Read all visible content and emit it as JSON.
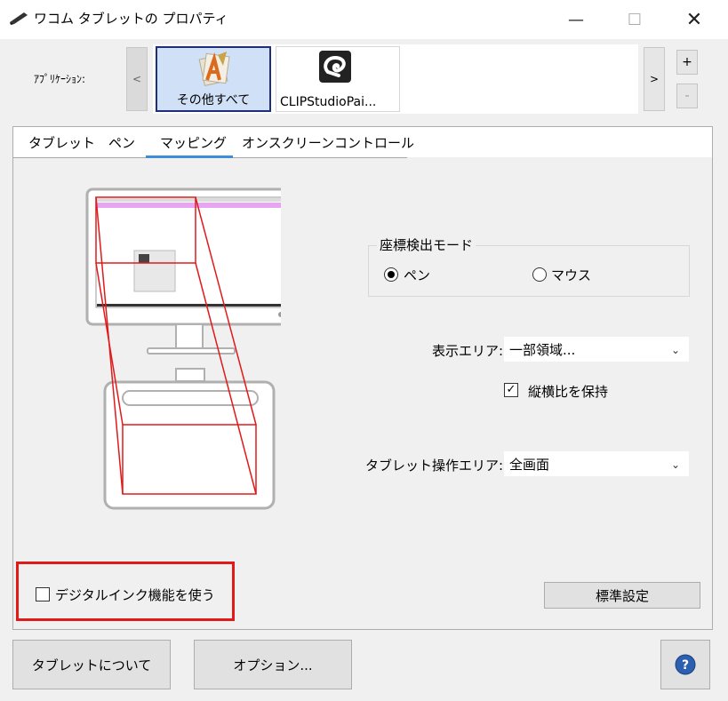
{
  "window": {
    "title": "ワコム タブレットの プロパティ",
    "minimize_glyph": "—",
    "maximize_glyph": "☐",
    "close_glyph": "✕"
  },
  "applications": {
    "label": "ｱﾌﾟﾘｹｰｼｮﾝ:",
    "scroll_left_glyph": "<",
    "scroll_right_glyph": ">",
    "add_glyph": "+",
    "remove_glyph": "-",
    "items": [
      {
        "label": "その他すべて",
        "icon": "all-apps-icon",
        "selected": true
      },
      {
        "label": "CLIPStudioPai...",
        "icon": "clip-studio-icon",
        "selected": false
      }
    ]
  },
  "tabs": [
    {
      "label": "タブレット",
      "active": false
    },
    {
      "label": "ペン",
      "active": false
    },
    {
      "label": "マッピング",
      "active": true
    },
    {
      "label": "オンスクリーンコントロール",
      "active": false
    }
  ],
  "mapping": {
    "coord_mode": {
      "legend": "座標検出モード",
      "pen_label": "ペン",
      "mouse_label": "マウス",
      "selected": "pen"
    },
    "display_area": {
      "label": "表示エリア:",
      "value": "一部領域..."
    },
    "keep_aspect": {
      "label": "縦横比を保持",
      "checked": true,
      "check_glyph": "✓"
    },
    "tablet_area": {
      "label": "タブレット操作エリア:",
      "value": "全画面"
    },
    "digital_ink": {
      "label": "デジタルインク機能を使う",
      "checked": false
    },
    "default_button": "標準設定",
    "chevron_glyph": "⌄"
  },
  "footer": {
    "about_button": "タブレットについて",
    "options_button": "オプション...",
    "help_glyph": "?"
  },
  "colors": {
    "highlight_red": "#e01a1a",
    "tab_accent": "#3e8ddd",
    "selected_tile": "#cfe0f7",
    "help_blue": "#2d5fb0"
  }
}
